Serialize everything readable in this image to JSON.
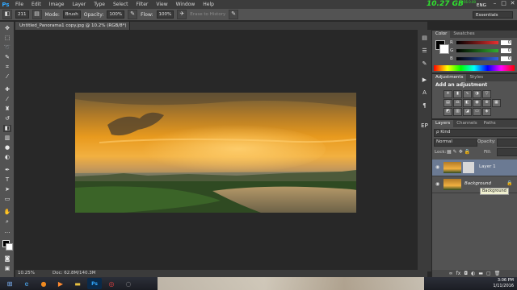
{
  "app": {
    "logo": "Ps",
    "menu": [
      "File",
      "Edit",
      "Image",
      "Layer",
      "Type",
      "Select",
      "Filter",
      "View",
      "Window",
      "Help"
    ],
    "window_controls": [
      "–",
      "□",
      "✕"
    ]
  },
  "overlay": {
    "memory_main": "10.27 GB",
    "memory_small": "3.56\n0.00"
  },
  "options": {
    "brush_size": "211",
    "mode_label": "Mode:",
    "mode_value": "Brush",
    "opacity_label": "Opacity:",
    "opacity_value": "100%",
    "flow_label": "Flow:",
    "flow_value": "100%",
    "erase_history": "Erase to History",
    "workspace": "Essentials"
  },
  "document": {
    "tab_title": "Untitled_Panorama1 copy.jpg @ 10.2% (RGB/8*) ×",
    "zoom": "10.25%",
    "doc_size": "Doc: 62.8M/140.3M"
  },
  "color_panel": {
    "tabs": [
      "Color",
      "Swatches"
    ],
    "sliders": [
      {
        "label": "R",
        "value": "0",
        "color": "#e83030"
      },
      {
        "label": "G",
        "value": "0",
        "color": "#30b030"
      },
      {
        "label": "B",
        "value": "0",
        "color": "#3060e0"
      }
    ]
  },
  "adjustments_panel": {
    "tabs": [
      "Adjustments",
      "Styles"
    ],
    "title": "Add an adjustment",
    "icons": [
      "brightness-icon",
      "levels-icon",
      "curves-icon",
      "exposure-icon",
      "vibrance-icon",
      "hue-saturation-icon",
      "color-balance-icon",
      "black-white-icon",
      "photo-filter-icon",
      "channel-mixer-icon",
      "color-lookup-icon",
      "invert-icon",
      "posterize-icon",
      "threshold-icon",
      "gradient-map-icon",
      "selective-color-icon"
    ]
  },
  "side_label": "EP",
  "layers_panel": {
    "tabs": [
      "Layers",
      "Channels",
      "Paths"
    ],
    "filter": "ρ Kind",
    "blend_mode": "Normal",
    "opacity_label": "Opacity:",
    "lock_label": "Lock:",
    "fill_label": "Fill:",
    "layers": [
      {
        "name": "Layer 1",
        "has_mask": true
      },
      {
        "name": "Background",
        "locked": true
      }
    ],
    "tooltip": "Background",
    "footer_icons": [
      "link-icon",
      "fx-icon",
      "mask-icon",
      "adjustment-icon",
      "folder-icon",
      "new-layer-icon",
      "trash-icon"
    ]
  },
  "taskbar": {
    "language": "ENG",
    "time": "3:06 PM",
    "date": "1/11/2016",
    "apps": [
      "start-icon",
      "ie-icon",
      "firefox-icon",
      "media-icon",
      "explorer-icon",
      "photoshop-icon",
      "chrome-icon",
      "edge-icon"
    ]
  }
}
